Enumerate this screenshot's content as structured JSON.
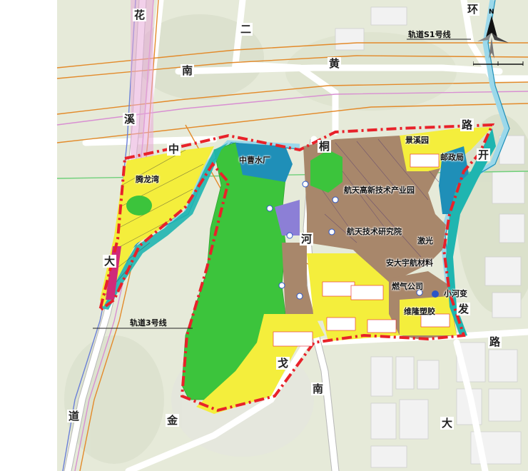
{
  "road_labels": [
    "花",
    "南",
    "溪",
    "中",
    "大",
    "道",
    "二",
    "黄",
    "桐",
    "河",
    "戈",
    "南",
    "金",
    "环",
    "路",
    "开",
    "发",
    "路",
    "大"
  ],
  "place_labels": {
    "tenglong": "腾龙湾",
    "zhongcao": "中曹水厂",
    "jingxi": "景溪园",
    "post": "邮政局",
    "hangtian_park": "航天高新技术产业园",
    "hangtian_inst": "航天技术研究院",
    "laser": "激光",
    "anda": "安大宇航材料",
    "gas": "燃气公司",
    "xiaohe": "小河变",
    "weilong": "维隆塑胶"
  },
  "rail_labels": {
    "s1": "轨道S1号线",
    "line3": "轨道3号线"
  },
  "legend_colors": {
    "residential": "#f4ee3c",
    "industrial": "#a8876b",
    "greenspace": "#3cc43c",
    "water": "#1f8fb8",
    "utility": "#8c7fd6",
    "boundary": "#e8222a"
  },
  "icons": [
    "north-arrow-icon"
  ]
}
